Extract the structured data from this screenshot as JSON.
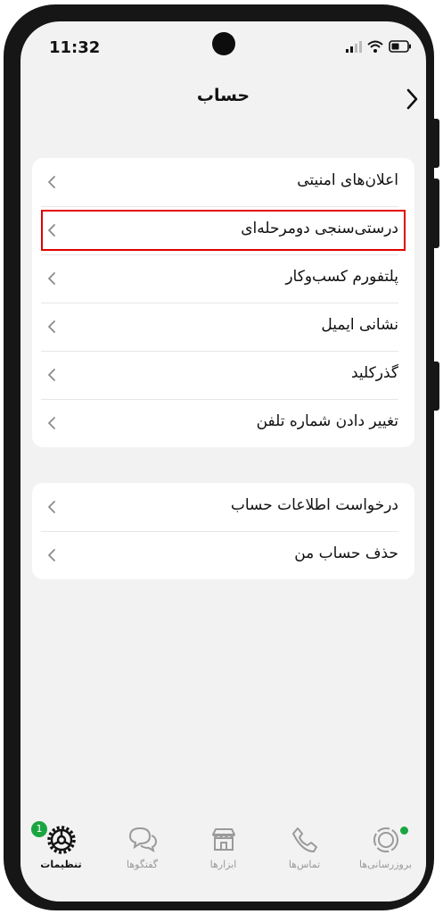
{
  "status_bar": {
    "time": "11:32"
  },
  "header": {
    "title": "حساب"
  },
  "group1": [
    {
      "label": "اعلان‌های امنیتی"
    },
    {
      "label": "درستی‌سنجی دومرحله‌ای",
      "highlighted": true
    },
    {
      "label": "پلتفورم کسب‌وکار"
    },
    {
      "label": "نشانی ایمیل"
    },
    {
      "label": "گذرکلید"
    },
    {
      "label": "تغییر دادن شماره تلفن"
    }
  ],
  "group2": [
    {
      "label": "درخواست اطلاعات حساب"
    },
    {
      "label": "حذف حساب من"
    }
  ],
  "tabbar": {
    "settings": {
      "label": "تنظیمات",
      "badge": "1",
      "icon": "gear-icon",
      "active": true
    },
    "chats": {
      "label": "گفتگوها",
      "icon": "chat-bubbles-icon"
    },
    "tools": {
      "label": "ابزارها",
      "icon": "store-icon"
    },
    "calls": {
      "label": "تماس‌ها",
      "icon": "phone-icon"
    },
    "updates": {
      "label": "بروزرسانی‌ها",
      "icon": "status-icon"
    }
  },
  "colors": {
    "highlight": "#e10000",
    "accent": "#1aa541",
    "background": "#f2f2f2"
  }
}
